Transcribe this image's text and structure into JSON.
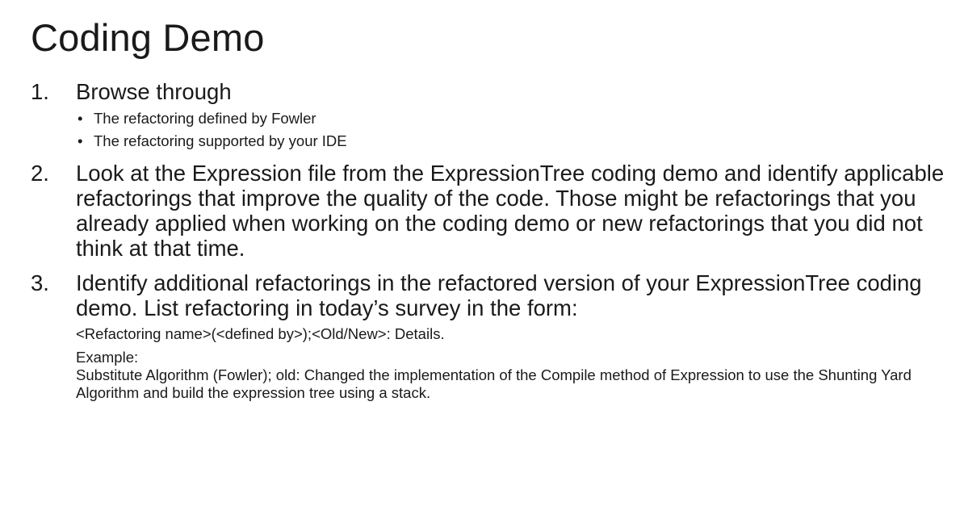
{
  "slide": {
    "title": "Coding Demo",
    "items": [
      {
        "number": "1.",
        "text": "Browse through",
        "subitems": [
          "The refactoring defined by Fowler",
          "The refactoring supported by your IDE"
        ]
      },
      {
        "number": "2.",
        "text": "Look at the Expression file from the ExpressionTree coding demo and identify applicable refactorings that improve the quality of the code. Those might be refactorings that you already applied when working on the coding demo or new refactorings that you did not think at that time."
      },
      {
        "number": "3.",
        "text": "Identify additional refactorings in the refactored version of your ExpressionTree coding demo. List refactoring in today’s survey in the form:",
        "format": "<Refactoring name>(<defined by>);<Old/New>: Details.",
        "example_label": "Example:",
        "example_text": "Substitute Algorithm (Fowler); old: Changed the implementation of the Compile method of Expression to use the Shunting Yard Algorithm and build the expression tree using a stack."
      }
    ],
    "bullet_glyph": "•"
  }
}
